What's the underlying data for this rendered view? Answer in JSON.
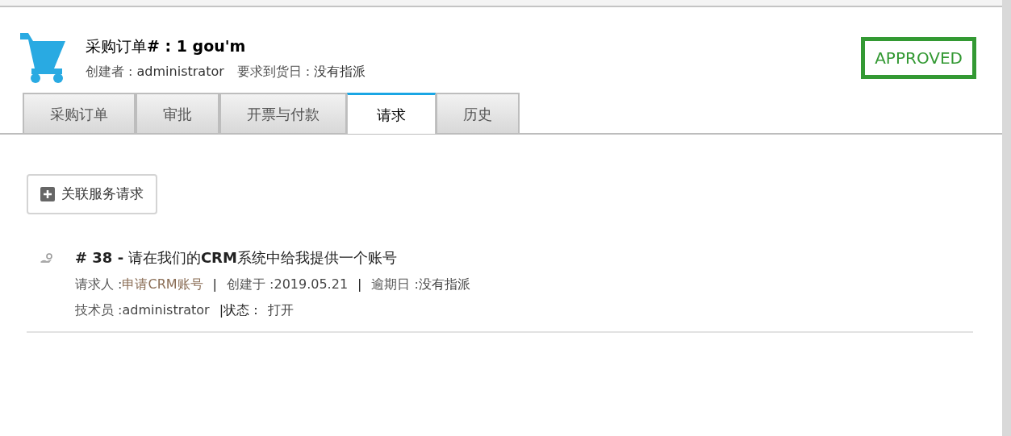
{
  "header": {
    "title": "采购订单**# : 1 gou'm**",
    "meta": [
      {
        "label": "创建者 : ",
        "value": "administrator"
      },
      {
        "label": "要求到货日 : ",
        "value": "没有指派"
      }
    ],
    "status": "APPROVED"
  },
  "tabs": [
    {
      "label": "采购订单",
      "selected": false
    },
    {
      "label": "审批",
      "selected": false
    },
    {
      "label": "开票与付款",
      "selected": false
    },
    {
      "label": "请求",
      "selected": true
    },
    {
      "label": "历史",
      "selected": false
    }
  ],
  "add_button": "关联服务请求",
  "requests": [
    {
      "title": "**# 38 -** 请在我们的**CRM**系统中给我提供一个账号",
      "lines": [
        [
          {
            "kind": "label",
            "text": "请求人 : "
          },
          {
            "kind": "link",
            "text": "申请CRM账号"
          },
          {
            "kind": "sep",
            "text": "|"
          },
          {
            "kind": "label",
            "text": "创建于 : "
          },
          {
            "kind": "value",
            "text": "2019.05.21"
          },
          {
            "kind": "sep",
            "text": "|"
          },
          {
            "kind": "label",
            "text": "逾期日 : "
          },
          {
            "kind": "value",
            "text": "没有指派"
          }
        ],
        [
          {
            "kind": "label",
            "text": "技术员 : "
          },
          {
            "kind": "value",
            "text": "administrator"
          },
          {
            "kind": "sep",
            "text": "|状态 :"
          },
          {
            "kind": "value",
            "text": "打开"
          }
        ]
      ]
    }
  ]
}
